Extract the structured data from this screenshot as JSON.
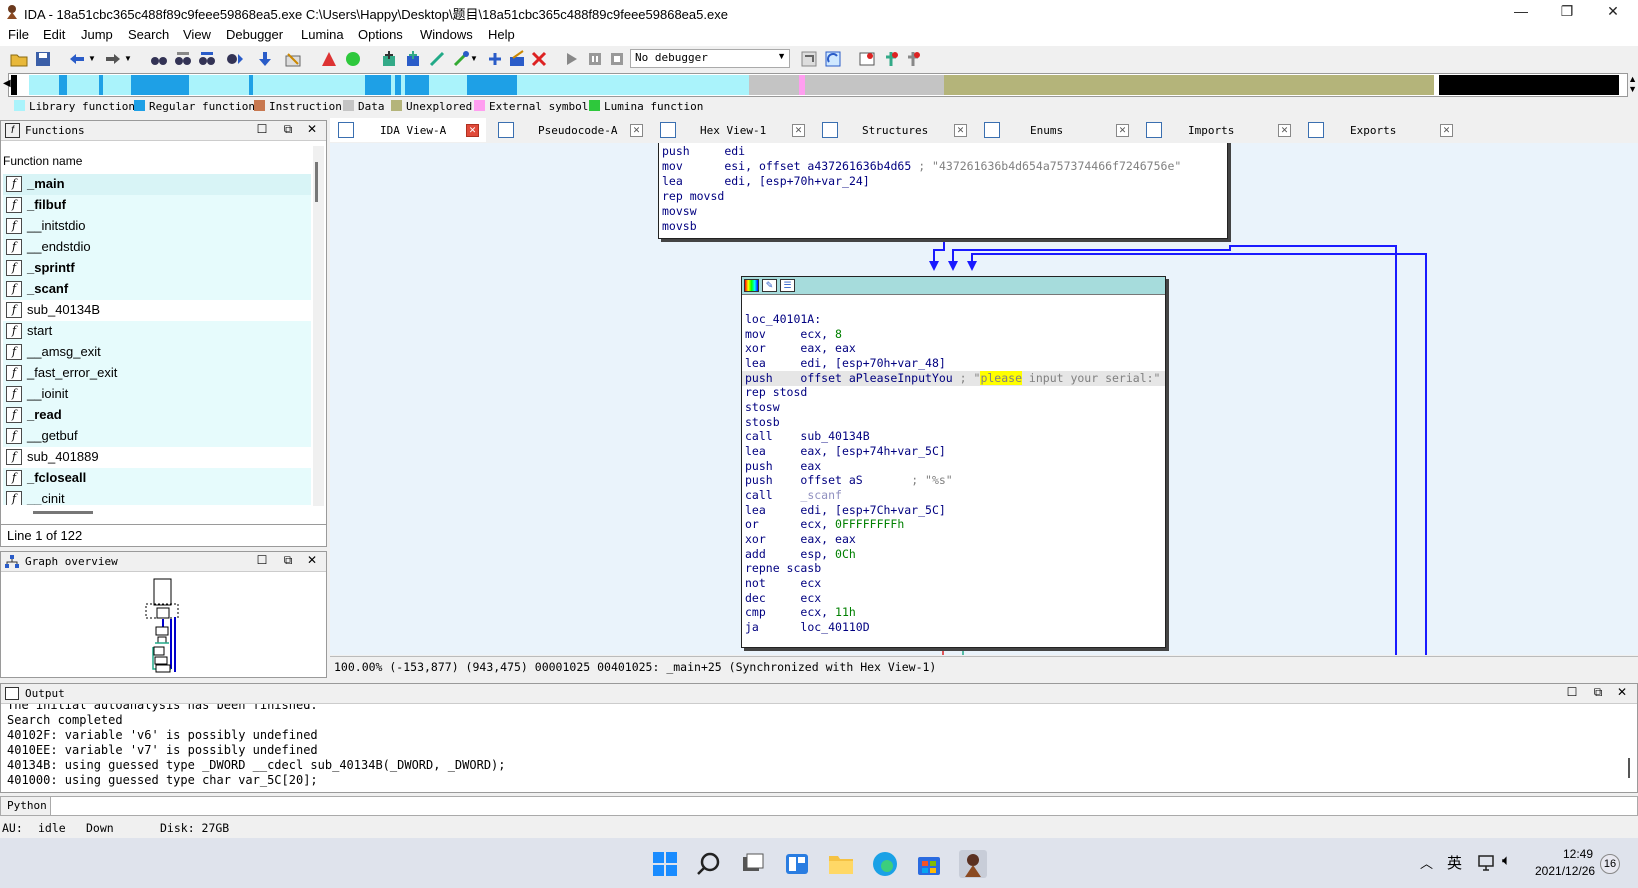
{
  "window": {
    "title": "IDA - 18a51cbc365c488f89c9feee59868ea5.exe C:\\Users\\Happy\\Desktop\\题目\\18a51cbc365c488f89c9feee59868ea5.exe",
    "minimize": "—",
    "maximize": "❐",
    "close": "✕"
  },
  "menu": [
    "File",
    "Edit",
    "Jump",
    "Search",
    "View",
    "Debugger",
    "Lumina",
    "Options",
    "Windows",
    "Help"
  ],
  "toolbar": {
    "debugger_select": "No debugger"
  },
  "legend": [
    {
      "label": "Library function",
      "color": "#aaf3fb"
    },
    {
      "label": "Regular function",
      "color": "#1ea0e6"
    },
    {
      "label": "Instruction",
      "color": "#c87850"
    },
    {
      "label": "Data",
      "color": "#c4c4c4"
    },
    {
      "label": "Unexplored",
      "color": "#b4b47a"
    },
    {
      "label": "External symbol",
      "color": "#ff9ef0"
    },
    {
      "label": "Lumina function",
      "color": "#2ec83c"
    }
  ],
  "functions_panel": {
    "title": "Functions",
    "column": "Function name",
    "items": [
      {
        "name": "_main",
        "bold": true
      },
      {
        "name": "_filbuf",
        "bold": true
      },
      {
        "name": "__initstdio",
        "bold": false
      },
      {
        "name": "__endstdio",
        "bold": false
      },
      {
        "name": "_sprintf",
        "bold": true
      },
      {
        "name": "_scanf",
        "bold": true
      },
      {
        "name": "sub_40134B",
        "bold": false
      },
      {
        "name": "start",
        "bold": false
      },
      {
        "name": "__amsg_exit",
        "bold": false
      },
      {
        "name": "_fast_error_exit",
        "bold": false
      },
      {
        "name": "__ioinit",
        "bold": false
      },
      {
        "name": "_read",
        "bold": true
      },
      {
        "name": "__getbuf",
        "bold": false
      },
      {
        "name": "sub_401889",
        "bold": false
      },
      {
        "name": "_fcloseall",
        "bold": true
      },
      {
        "name": "__cinit",
        "bold": false
      }
    ],
    "line_info": "Line 1 of 122"
  },
  "graph_overview": {
    "title": "Graph overview"
  },
  "tabs": [
    {
      "label": "IDA View-A",
      "active": true
    },
    {
      "label": "Pseudocode-A"
    },
    {
      "label": "Hex View-1"
    },
    {
      "label": "Structures"
    },
    {
      "label": "Enums"
    },
    {
      "label": "Imports"
    },
    {
      "label": "Exports"
    }
  ],
  "code_top": [
    {
      "mn": "push",
      "op": "edi",
      "cm": ""
    },
    {
      "mn": "mov",
      "op": "esi, offset a437261636b4d65",
      "cm": "; \"437261636b4d654a757374466f7246756e\""
    },
    {
      "mn": "lea",
      "op": "edi, [esp+70h+var_24]",
      "cm": ""
    },
    {
      "mn": "rep movsd",
      "op": "",
      "cm": ""
    },
    {
      "mn": "movsw",
      "op": "",
      "cm": ""
    },
    {
      "mn": "movsb",
      "op": "",
      "cm": ""
    }
  ],
  "code_main": {
    "label": "loc_40101A:",
    "lines": [
      {
        "mn": "mov",
        "op": "ecx, 8"
      },
      {
        "mn": "xor",
        "op": "eax, eax"
      },
      {
        "mn": "lea",
        "op": "edi, [esp+70h+var_48]"
      },
      {
        "mn": "push",
        "op": "offset aPleaseInputYou",
        "cm_pre": "; \"",
        "cm_hl": "please",
        "cm_post": " input your serial:\""
      },
      {
        "mn": "rep stosd",
        "op": ""
      },
      {
        "mn": "stosw",
        "op": ""
      },
      {
        "mn": "stosb",
        "op": ""
      },
      {
        "mn": "call",
        "op": "sub_40134B"
      },
      {
        "mn": "lea",
        "op": "eax, [esp+74h+var_5C]"
      },
      {
        "mn": "push",
        "op": "eax"
      },
      {
        "mn": "push",
        "op": "offset aS",
        "cm": "; \"%s\""
      },
      {
        "mn": "call",
        "op": "_scanf"
      },
      {
        "mn": "lea",
        "op": "edi, [esp+7Ch+var_5C]"
      },
      {
        "mn": "or",
        "op": "ecx, 0FFFFFFFFh"
      },
      {
        "mn": "xor",
        "op": "eax, eax"
      },
      {
        "mn": "add",
        "op": "esp, 0Ch"
      },
      {
        "mn": "repne scasb",
        "op": ""
      },
      {
        "mn": "not",
        "op": "ecx"
      },
      {
        "mn": "dec",
        "op": "ecx"
      },
      {
        "mn": "cmp",
        "op": "ecx, 11h"
      },
      {
        "mn": "ja",
        "op": "loc_40110D"
      }
    ]
  },
  "status_line": "100.00% (-153,877) (943,475) 00001025 00401025: _main+25 (Synchronized with Hex View-1)",
  "output": {
    "title": "Output",
    "lines": [
      "The initial autoanalysis has been finished.",
      "Search completed",
      "40102F: variable 'v6' is possibly undefined",
      "4010EE: variable 'v7' is possibly undefined",
      "40134B: using guessed type _DWORD __cdecl sub_40134B(_DWORD, _DWORD);",
      "401000: using guessed type char var_5C[20];"
    ]
  },
  "python_label": "Python",
  "statusbar": {
    "au": "AU:",
    "state": "idle",
    "dir": "Down",
    "disk": "Disk: 27GB"
  },
  "taskbar": {
    "ime": "英",
    "time": "12:49",
    "date": "2021/12/26",
    "badge": "16"
  }
}
